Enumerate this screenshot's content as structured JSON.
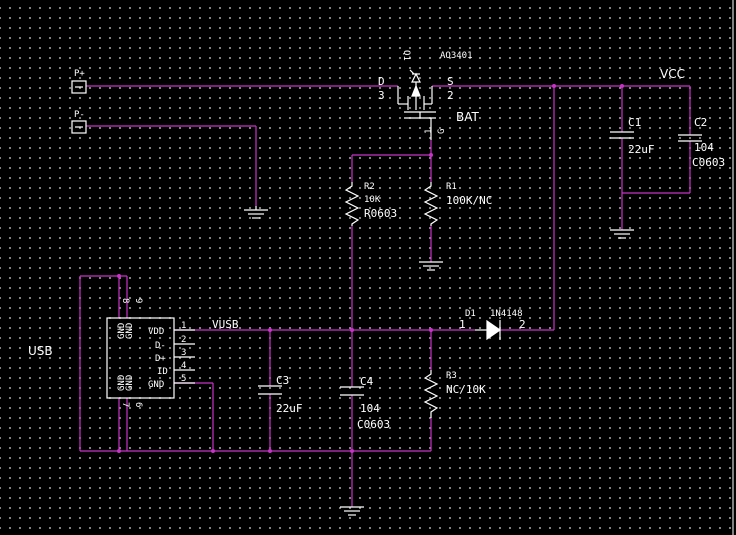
{
  "nets": {
    "vcc": "VCC",
    "bat": "BAT",
    "vusb": "VUSB",
    "usb": "USB"
  },
  "connectors": {
    "p_plus": "P+",
    "p_minus": "P-"
  },
  "q1": {
    "ref": "Q1",
    "part": "AO3401",
    "d": "D",
    "s": "S",
    "pin3": "3",
    "pin2": "2",
    "pin1": "1",
    "g": "G"
  },
  "r1": {
    "ref": "R1",
    "value": "100K/NC"
  },
  "r2": {
    "ref": "R2",
    "value": "10K",
    "package": "R0603"
  },
  "r3": {
    "ref": "R3",
    "value": "NC/10K"
  },
  "c1": {
    "ref": "C1",
    "value": "22uF"
  },
  "c2": {
    "ref": "C2",
    "value": "104",
    "package": "C0603"
  },
  "c3": {
    "ref": "C3",
    "value": "22uF"
  },
  "c4": {
    "ref": "C4",
    "value": "104",
    "package": "C0603"
  },
  "d1": {
    "ref": "D1",
    "part": "1N4148",
    "pin1": "1",
    "pin2": "2"
  },
  "usb_connector": {
    "pins_right": [
      "VDD",
      "D-",
      "D+",
      "ID",
      "GND"
    ],
    "pin_numbers": [
      "1",
      "2",
      "3",
      "4",
      "5"
    ],
    "gnd_top": [
      "GND",
      "GND"
    ],
    "gnd_top_nums": [
      "8",
      "9"
    ],
    "gnd_bottom": [
      "GND",
      "GND"
    ],
    "gnd_bottom_nums": [
      "7",
      "6"
    ]
  },
  "colors": {
    "wire": "#c832c8",
    "part": "#ffffff",
    "grid": "#9a9a9a",
    "background": "#000000"
  }
}
